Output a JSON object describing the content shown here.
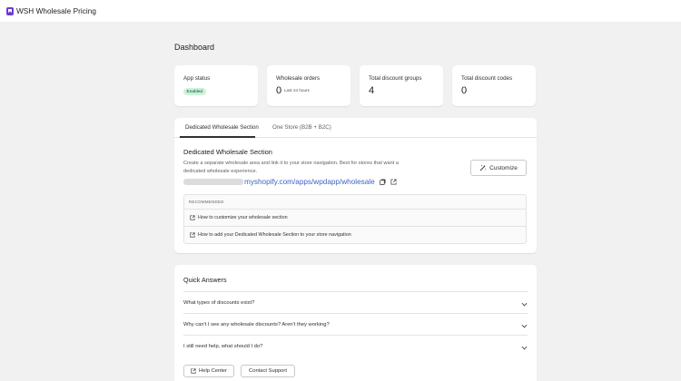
{
  "app": {
    "title": "WSH Wholesale Pricing",
    "brand_color": "#6b3bd4"
  },
  "page": {
    "title": "Dashboard"
  },
  "stats": [
    {
      "label": "App status",
      "badge": "Enabled"
    },
    {
      "label": "Wholesale orders",
      "value": "0",
      "sub": "Last 24 hours"
    },
    {
      "label": "Total discount groups",
      "value": "4"
    },
    {
      "label": "Total discount codes",
      "value": "0"
    }
  ],
  "tabs": [
    {
      "label": "Dedicated Wholesale Section",
      "active": true
    },
    {
      "label": "One Store (B2B + B2C)",
      "active": false
    }
  ],
  "section": {
    "title": "Dedicated Wholesale Section",
    "description": "Create a separate wholesale area and link it to your store navigation. Best for stores that want a dedicated wholesale experience.",
    "customize_label": "Customize",
    "url_suffix": "myshopify.com/apps/wpdapp/wholesale",
    "link_color": "#3a64c4"
  },
  "recommended": {
    "heading": "RECOMMENDED",
    "items": [
      {
        "label": "How to customize your wholesale section",
        "icon": "external-link-icon"
      },
      {
        "label": "How to add your Dedicated Wholesale Section to your store navigation",
        "icon": "external-link-icon"
      }
    ]
  },
  "quick_answers": {
    "title": "Quick Answers",
    "questions": [
      "What types of discounts exist?",
      "Why can't I see any wholesale discounts? Aren't they working?",
      "I still need help, what should I do?"
    ],
    "help_center_label": "Help Center",
    "contact_support_label": "Contact Support"
  }
}
